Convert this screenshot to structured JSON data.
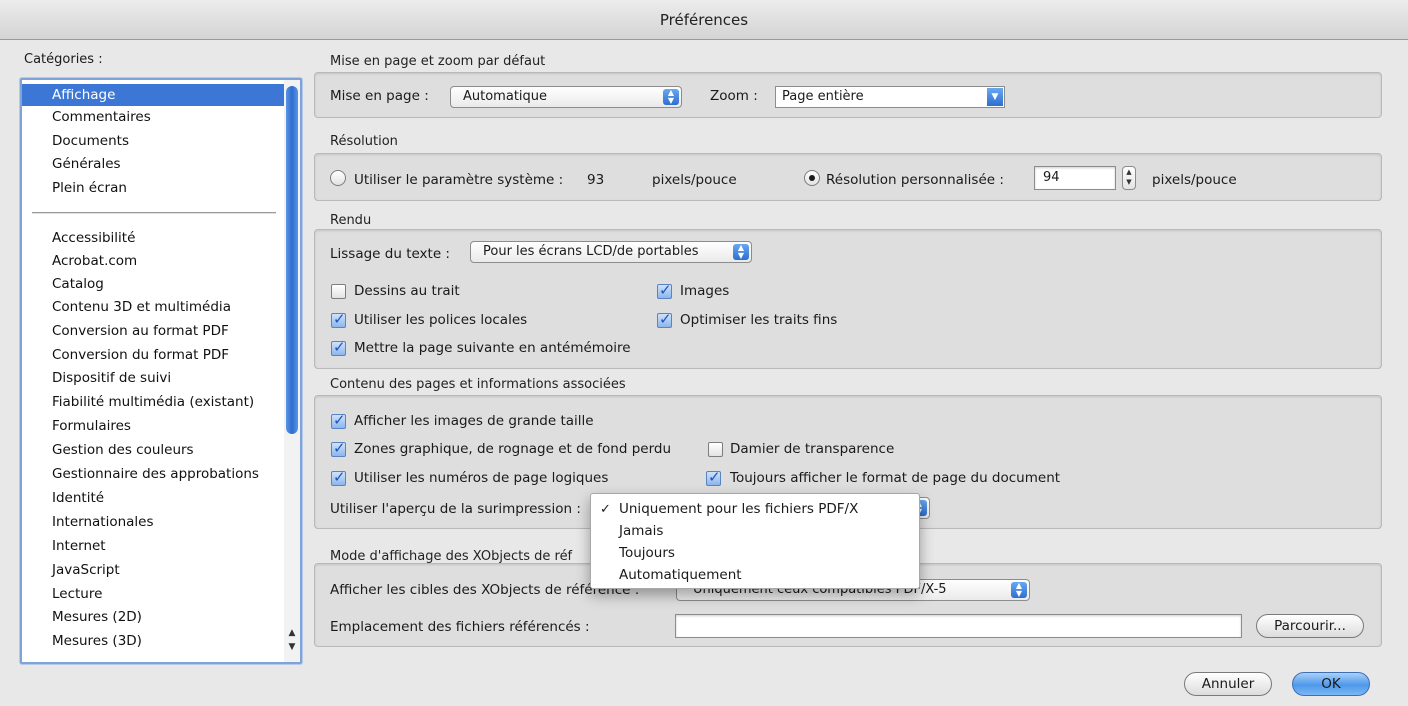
{
  "window": {
    "title": "Préférences"
  },
  "sidebar": {
    "title": "Catégories :",
    "top_items": [
      {
        "label": "Affichage",
        "selected": true
      },
      {
        "label": "Commentaires"
      },
      {
        "label": "Documents"
      },
      {
        "label": "Générales"
      },
      {
        "label": "Plein écran"
      }
    ],
    "items": [
      {
        "label": "Accessibilité"
      },
      {
        "label": "Acrobat.com"
      },
      {
        "label": "Catalog"
      },
      {
        "label": "Contenu 3D et multimédia"
      },
      {
        "label": "Conversion au format PDF"
      },
      {
        "label": "Conversion du format PDF"
      },
      {
        "label": "Dispositif de suivi"
      },
      {
        "label": "Fiabilité multimédia (existant)"
      },
      {
        "label": "Formulaires"
      },
      {
        "label": "Gestion des couleurs"
      },
      {
        "label": "Gestionnaire des approbations"
      },
      {
        "label": "Identité"
      },
      {
        "label": "Internationales"
      },
      {
        "label": "Internet"
      },
      {
        "label": "JavaScript"
      },
      {
        "label": "Lecture"
      },
      {
        "label": "Mesures (2D)"
      },
      {
        "label": "Mesures (3D)"
      }
    ]
  },
  "layout_zoom": {
    "title": "Mise en page et zoom par défaut",
    "page_layout_label": "Mise en page :",
    "page_layout_value": "Automatique",
    "zoom_label": "Zoom :",
    "zoom_value": "Page entière"
  },
  "resolution": {
    "title": "Résolution",
    "system_label": "Utiliser le paramètre système :",
    "system_value": "93",
    "system_unit": "pixels/pouce",
    "custom_label": "Résolution personnalisée :",
    "custom_value": "94",
    "custom_unit": "pixels/pouce",
    "selected": "custom"
  },
  "rendering": {
    "title": "Rendu",
    "smoothing_label": "Lissage du texte :",
    "smoothing_value": "Pour les écrans LCD/de portables",
    "line_art": {
      "label": "Dessins au trait",
      "checked": false
    },
    "images": {
      "label": "Images",
      "checked": true
    },
    "local_fonts": {
      "label": "Utiliser les polices locales",
      "checked": true
    },
    "thin_lines": {
      "label": "Optimiser les traits fins",
      "checked": true
    },
    "cache_next": {
      "label": "Mettre la page suivante en antémémoire",
      "checked": true
    }
  },
  "page_content": {
    "title": "Contenu des pages et informations associées",
    "large_images": {
      "label": "Afficher les images de grande taille",
      "checked": true
    },
    "art_trim_bleed": {
      "label": "Zones graphique, de rognage et de fond perdu",
      "checked": true
    },
    "transparency_grid": {
      "label": "Damier de transparence",
      "checked": false
    },
    "logical_pages": {
      "label": "Utiliser les numéros de page logiques",
      "checked": true
    },
    "document_page_size": {
      "label": "Toujours afficher le format de page du document",
      "checked": true
    },
    "overprint_label": "Utiliser l'aperçu de la surimpression :"
  },
  "overprint_menu": {
    "check_glyph": "✓",
    "options": [
      {
        "label": "Uniquement pour les fichiers PDF/X",
        "selected": true
      },
      {
        "label": "Jamais"
      },
      {
        "label": "Toujours"
      },
      {
        "label": "Automatiquement"
      }
    ]
  },
  "xobjects": {
    "title": "Mode d'affichage des XObjects de réf",
    "targets_label": "Afficher les cibles des XObjects de référence :",
    "targets_value": "Uniquement ceux compatibles PDF/X-5",
    "location_label": "Emplacement des fichiers référencés :",
    "location_value": "",
    "browse_label": "Parcourir..."
  },
  "footer": {
    "cancel_label": "Annuler",
    "ok_label": "OK"
  },
  "colors": {
    "selection": "#3c77d6",
    "default_button": "#4e98ea"
  }
}
